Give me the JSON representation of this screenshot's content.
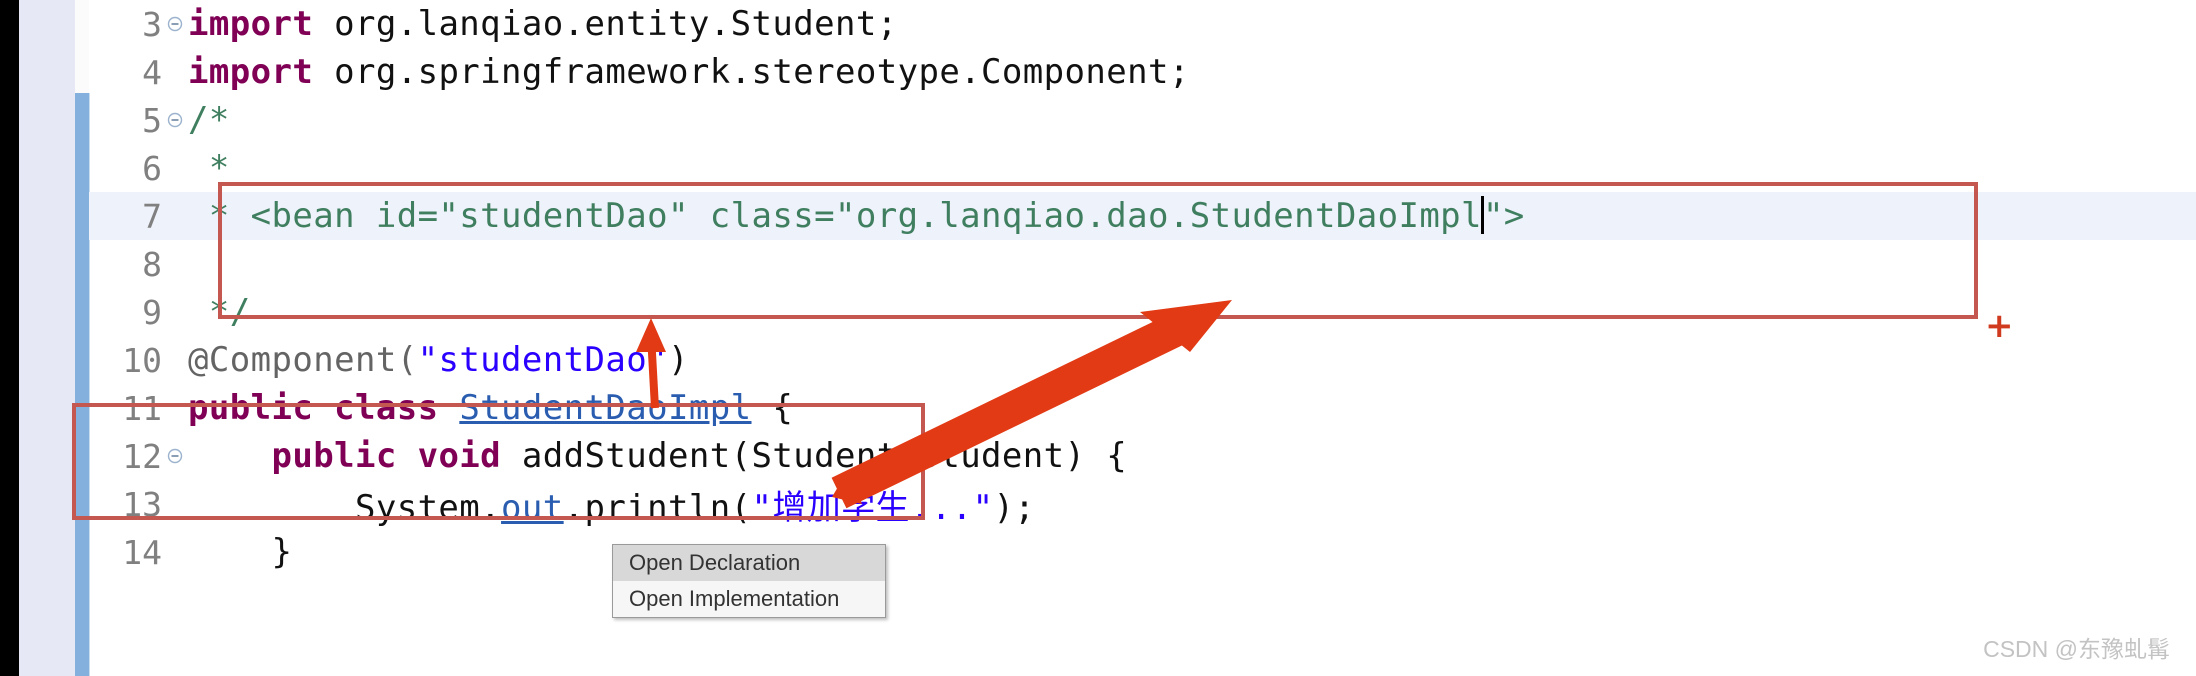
{
  "editor": {
    "lines": [
      {
        "number": "3",
        "fold": true,
        "highlighted": false,
        "segments": [
          {
            "text": "import ",
            "style": "kw"
          },
          {
            "text": "org.lanqiao.entity.Student;",
            "style": "plain"
          }
        ]
      },
      {
        "number": "4",
        "fold": false,
        "highlighted": false,
        "segments": [
          {
            "text": "import ",
            "style": "kw"
          },
          {
            "text": "org.springframework.stereotype.Component;",
            "style": "plain"
          }
        ]
      },
      {
        "number": "5",
        "fold": true,
        "highlighted": false,
        "segments": [
          {
            "text": "/*",
            "style": "comment"
          }
        ]
      },
      {
        "number": "6",
        "fold": false,
        "highlighted": false,
        "segments": [
          {
            "text": " *",
            "style": "comment"
          }
        ]
      },
      {
        "number": "7",
        "fold": false,
        "highlighted": true,
        "segments": [
          {
            "text": " * <bean id=\"studentDao\" class=\"org.lanqiao.dao.StudentDaoImpl",
            "style": "comment"
          },
          {
            "text": "",
            "style": "caret"
          },
          {
            "text": "\">",
            "style": "comment"
          }
        ]
      },
      {
        "number": "8",
        "fold": false,
        "highlighted": false,
        "segments": []
      },
      {
        "number": "9",
        "fold": false,
        "highlighted": false,
        "segments": [
          {
            "text": " */",
            "style": "comment"
          }
        ]
      },
      {
        "number": "10",
        "fold": false,
        "highlighted": false,
        "segments": [
          {
            "text": "@Component(",
            "style": "anno"
          },
          {
            "text": "\"studentDao\"",
            "style": "str"
          },
          {
            "text": ")",
            "style": "plain"
          }
        ]
      },
      {
        "number": "11",
        "fold": false,
        "highlighted": false,
        "segments": [
          {
            "text": "public class ",
            "style": "kw"
          },
          {
            "text": "StudentDaoImpl",
            "style": "link"
          },
          {
            "text": " {",
            "style": "plain"
          }
        ]
      },
      {
        "number": "12",
        "fold": true,
        "highlighted": false,
        "segments": [
          {
            "text": "    ",
            "style": "plain"
          },
          {
            "text": "public void ",
            "style": "kw"
          },
          {
            "text": "addStudent",
            "style": "plain"
          },
          {
            "text": "(Student student) {",
            "style": "plain"
          }
        ]
      },
      {
        "number": "13",
        "fold": false,
        "highlighted": false,
        "segments": [
          {
            "text": "        System.",
            "style": "plain"
          },
          {
            "text": "out",
            "style": "link"
          },
          {
            "text": ".println(",
            "style": "plain"
          },
          {
            "text": "\"增加学生...\"",
            "style": "str"
          },
          {
            "text": ");",
            "style": "plain"
          }
        ]
      },
      {
        "number": "14",
        "fold": false,
        "highlighted": false,
        "segments": [
          {
            "text": "    }",
            "style": "plain"
          }
        ]
      }
    ]
  },
  "popup": {
    "items": [
      {
        "label": "Open Declaration",
        "selected": true
      },
      {
        "label": "Open Implementation",
        "selected": false
      }
    ]
  },
  "annotations": {
    "plus_marker": "+",
    "box_bean_label": "bean-declaration-highlight-box",
    "box_class_label": "class-declaration-highlight-box"
  },
  "watermark": {
    "text": "CSDN @东豫虬髯"
  },
  "colors": {
    "annotation_box": "#c4574f",
    "arrow": "#e23a14",
    "keyword": "#7f0055",
    "comment": "#3f7f5f",
    "string": "#2a00ff",
    "link": "#2a5db0",
    "change_bar": "#84b0de",
    "highlight_row": "#eef2fb"
  }
}
